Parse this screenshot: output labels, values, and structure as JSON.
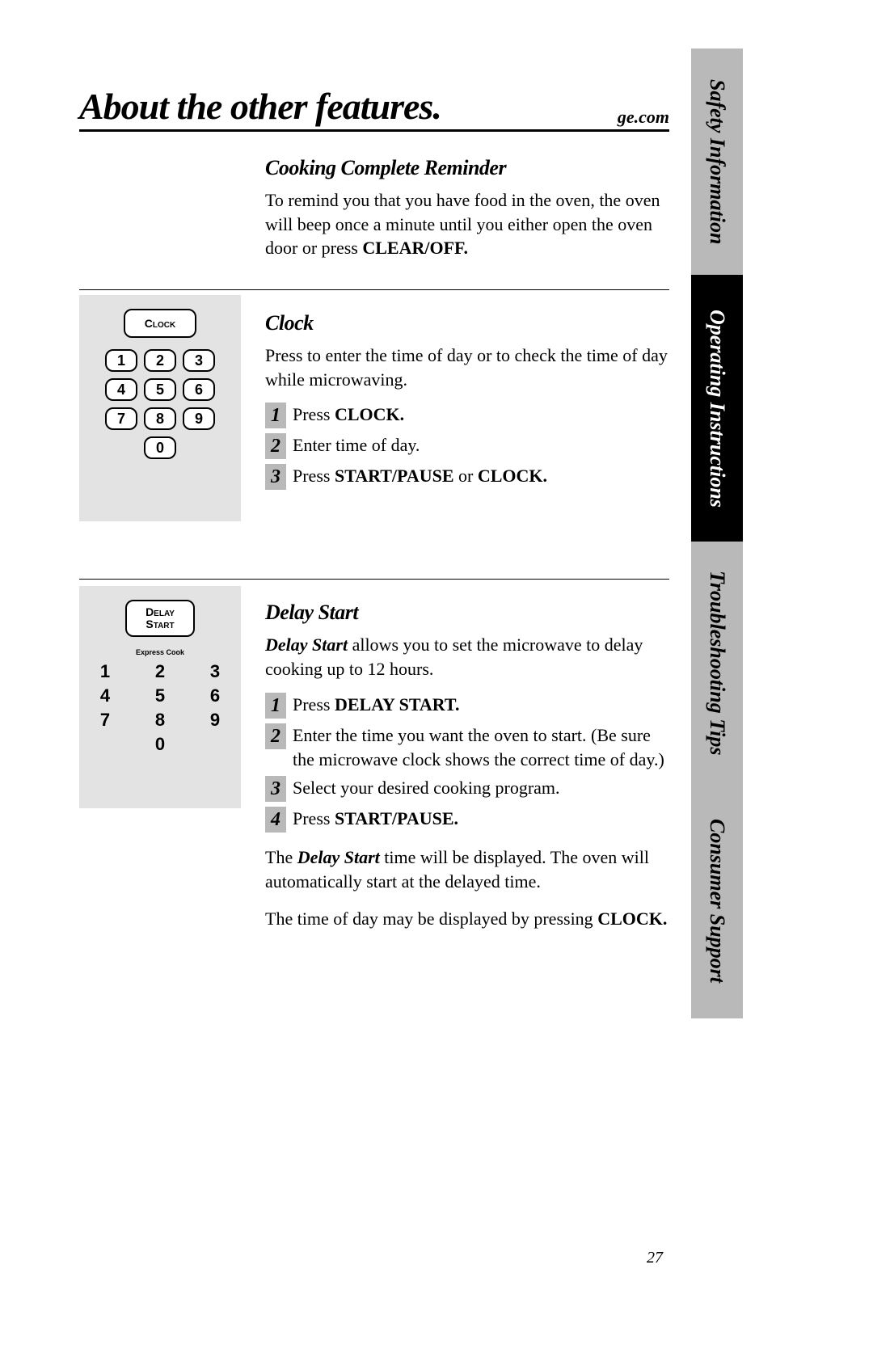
{
  "header": {
    "title": "About the other features.",
    "site": "ge.com"
  },
  "sections": {
    "reminder": {
      "heading": "Cooking Complete Reminder",
      "p1a": "To remind you that you have food in the oven, the oven will beep once a minute until you either open the oven door or press ",
      "p1b": "CLEAR/OFF."
    },
    "clock": {
      "heading": "Clock",
      "intro": "Press to enter the time of day or to check the time of day while microwaving.",
      "s1a": "Press ",
      "s1b": "CLOCK.",
      "s2": "Enter time of day.",
      "s3a": "Press ",
      "s3b": "START/PAUSE",
      "s3c": " or ",
      "s3d": "CLOCK."
    },
    "delay": {
      "heading": "Delay Start",
      "introA": "Delay Start",
      "introB": " allows you to set the microwave to delay cooking up to 12 hours.",
      "s1a": "Press ",
      "s1b": "DELAY START.",
      "s2": "Enter the time you want the oven to start. (Be sure the microwave clock shows the correct time of day.)",
      "s3": "Select your desired cooking program.",
      "s4a": "Press ",
      "s4b": "START/PAUSE.",
      "p2a": "The ",
      "p2b": "Delay Start",
      "p2c": " time will be displayed. The oven will automatically start at the delayed time.",
      "p3a": "The time of day may be displayed by pressing ",
      "p3b": "CLOCK."
    }
  },
  "keypad": {
    "clockLabel": "Clock",
    "delayLabelA": "Delay",
    "delayLabelB": "Start",
    "express": "Express Cook",
    "d1": "1",
    "d2": "2",
    "d3": "3",
    "d4": "4",
    "d5": "5",
    "d6": "6",
    "d7": "7",
    "d8": "8",
    "d9": "9",
    "d0": "0"
  },
  "tabs": {
    "safety": "Safety Information",
    "operating": "Operating Instructions",
    "troubleshoot": "Troubleshooting Tips",
    "consumer": "Consumer Support"
  },
  "steps": {
    "n1": "1",
    "n2": "2",
    "n3": "3",
    "n4": "4"
  },
  "page": "27"
}
